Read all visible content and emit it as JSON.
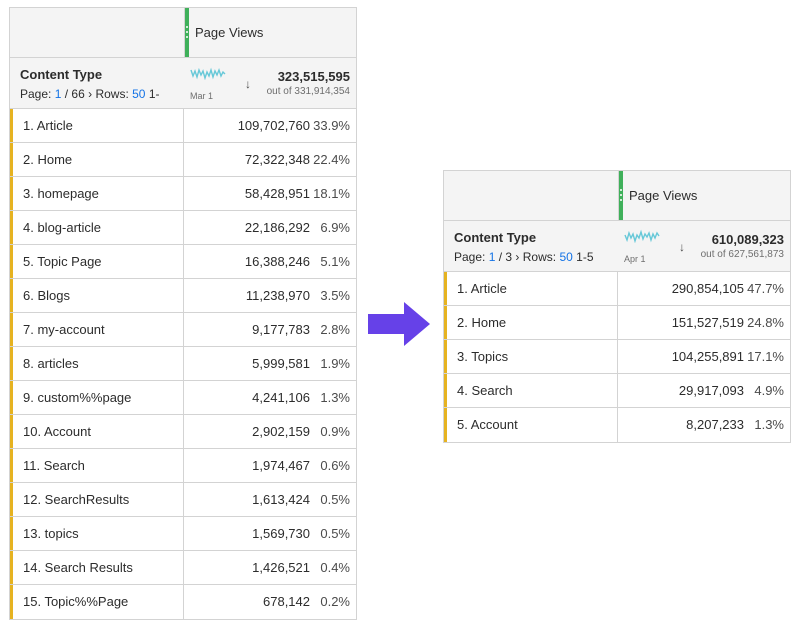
{
  "left_table": {
    "metric_header": "Page Views",
    "dimension": "Content Type",
    "pager": {
      "page_prefix": "Page:",
      "page": "1",
      "of": "/ 66",
      "rows_label": "Rows:",
      "rows": "50",
      "range": "1-"
    },
    "sparkline_date": "Mar 1",
    "total": "323,515,595",
    "out_of": "out of 331,914,354",
    "rows": [
      {
        "label": "1. Article",
        "value": "109,702,760",
        "pct": "33.9%"
      },
      {
        "label": "2. Home",
        "value": "72,322,348",
        "pct": "22.4%"
      },
      {
        "label": "3. homepage",
        "value": "58,428,951",
        "pct": "18.1%"
      },
      {
        "label": "4. blog-article",
        "value": "22,186,292",
        "pct": "6.9%"
      },
      {
        "label": "5. Topic Page",
        "value": "16,388,246",
        "pct": "5.1%"
      },
      {
        "label": "6. Blogs",
        "value": "11,238,970",
        "pct": "3.5%"
      },
      {
        "label": "7. my-account",
        "value": "9,177,783",
        "pct": "2.8%"
      },
      {
        "label": "8. articles",
        "value": "5,999,581",
        "pct": "1.9%"
      },
      {
        "label": "9. custom%%page",
        "value": "4,241,106",
        "pct": "1.3%"
      },
      {
        "label": "10. Account",
        "value": "2,902,159",
        "pct": "0.9%"
      },
      {
        "label": "11. Search",
        "value": "1,974,467",
        "pct": "0.6%"
      },
      {
        "label": "12. SearchResults",
        "value": "1,613,424",
        "pct": "0.5%"
      },
      {
        "label": "13. topics",
        "value": "1,569,730",
        "pct": "0.5%"
      },
      {
        "label": "14. Search Results",
        "value": "1,426,521",
        "pct": "0.4%"
      },
      {
        "label": "15. Topic%%Page",
        "value": "678,142",
        "pct": "0.2%"
      }
    ]
  },
  "right_table": {
    "metric_header": "Page Views",
    "dimension": "Content Type",
    "pager": {
      "page_prefix": "Page:",
      "page": "1",
      "of": "/ 3",
      "rows_label": "Rows:",
      "rows": "50",
      "range": "1-5"
    },
    "sparkline_date": "Apr 1",
    "total": "610,089,323",
    "out_of": "out of 627,561,873",
    "rows": [
      {
        "label": "1. Article",
        "value": "290,854,105",
        "pct": "47.7%"
      },
      {
        "label": "2. Home",
        "value": "151,527,519",
        "pct": "24.8%"
      },
      {
        "label": "3. Topics",
        "value": "104,255,891",
        "pct": "17.1%"
      },
      {
        "label": "4. Search",
        "value": "29,917,093",
        "pct": "4.9%"
      },
      {
        "label": "5. Account",
        "value": "8,207,233",
        "pct": "1.3%"
      }
    ]
  },
  "colors": {
    "row_bar": "#e6b321",
    "grip": "#3fb05a",
    "link": "#1473e6",
    "sparkline": "#67c8d8",
    "arrow": "#6641e8"
  },
  "icons": [
    "column-grip-icon",
    "sparkline-icon",
    "sort-descending-icon",
    "chevron-right-icon",
    "transform-arrow-icon"
  ]
}
